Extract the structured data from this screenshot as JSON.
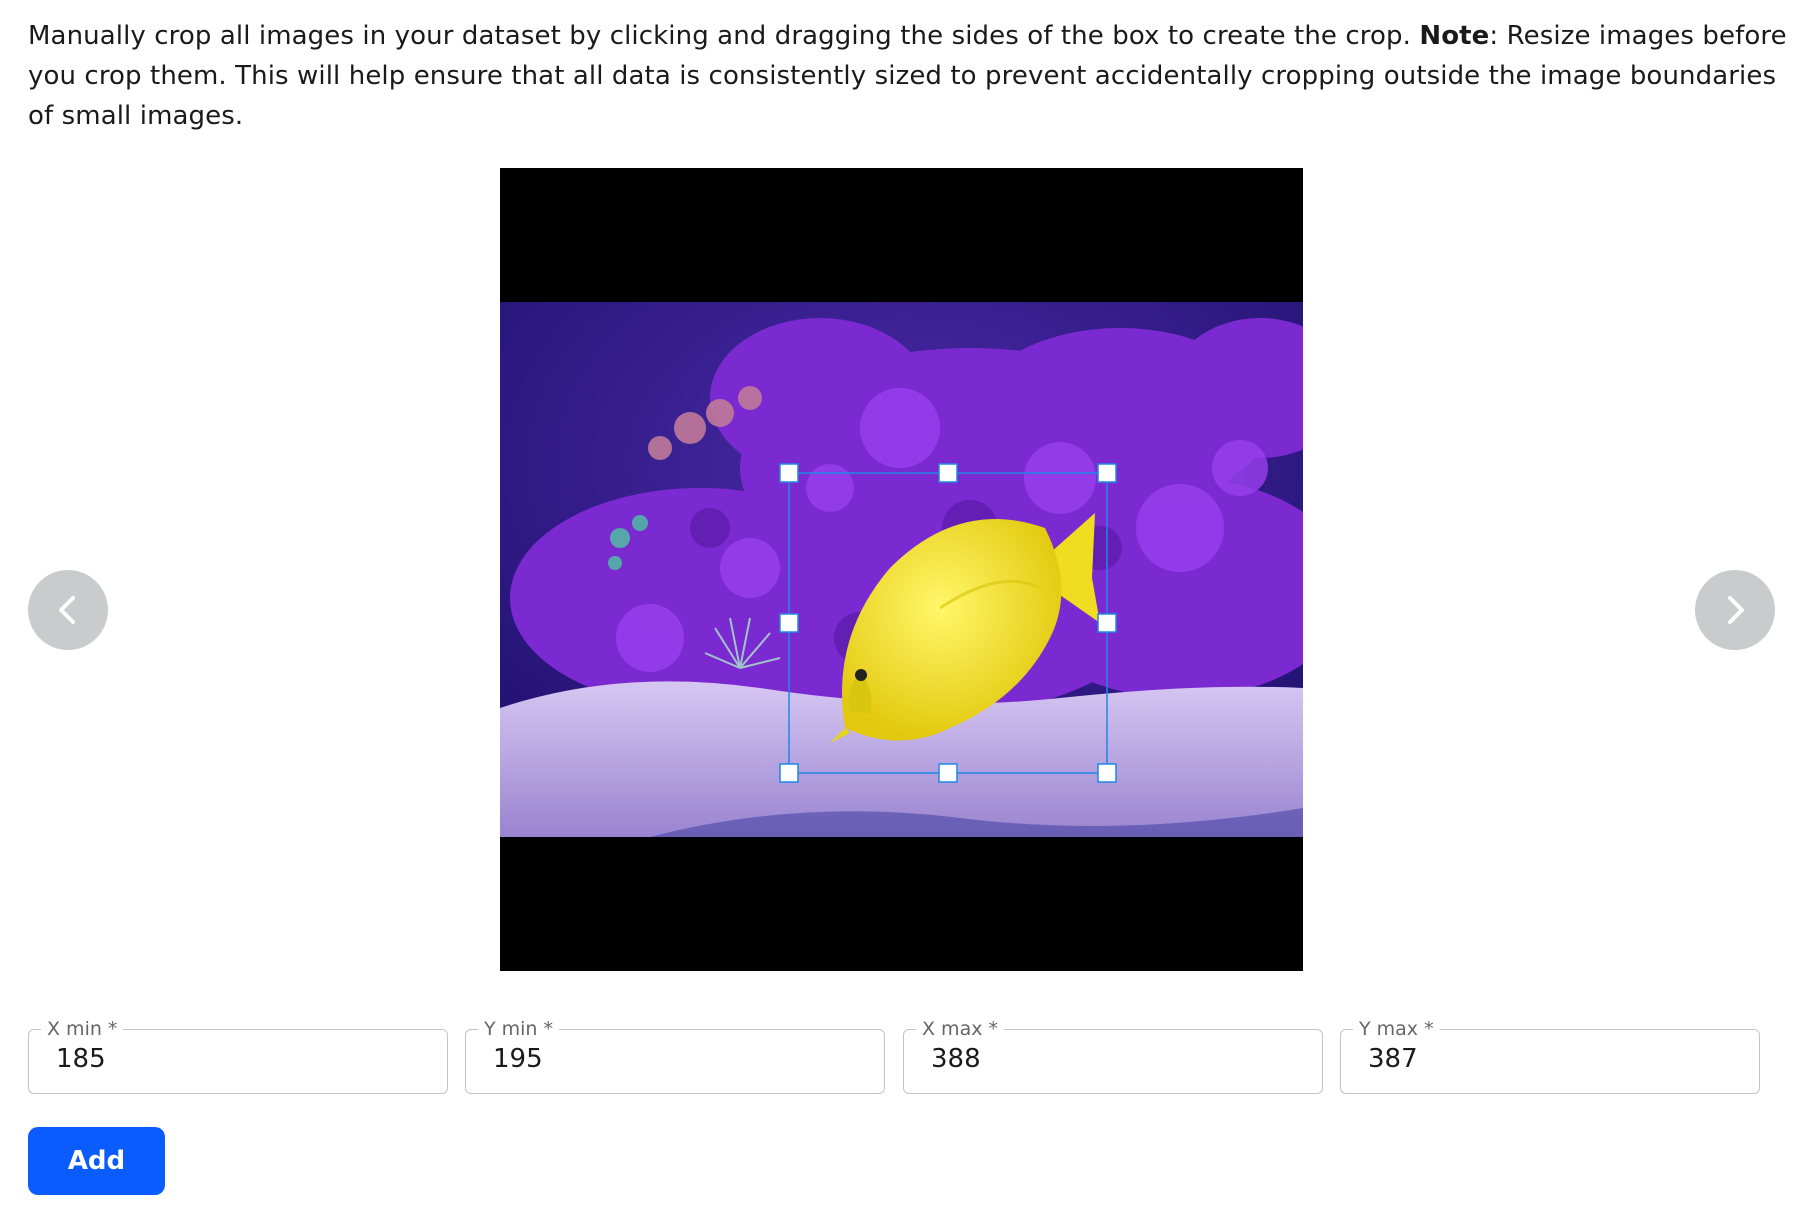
{
  "instructions": {
    "text_before_note": "Manually crop all images in your dataset by clicking and dragging the sides of the box to create the crop. ",
    "note_label": "Note",
    "text_after_note": ": Resize images before you crop them. This will help ensure that all data is consistently sized to prevent accidentally cropping outside the image boundaries of small images."
  },
  "image": {
    "subject": "yellow tang fish in aquarium with purple coral",
    "colors": {
      "letterbox": "#000000",
      "water": "#3a1a8c",
      "coral": "#7a2ad0",
      "sand": "#b9a6e0",
      "fish": "#f3e22a",
      "crop_box": "#1e88e5"
    }
  },
  "navigation": {
    "prev_icon": "chevron-left-icon",
    "next_icon": "chevron-right-icon",
    "button_color": "#c9cbcd"
  },
  "fields": [
    {
      "label": "X min *",
      "value": "185"
    },
    {
      "label": "Y min *",
      "value": "195"
    },
    {
      "label": "X max *",
      "value": "388"
    },
    {
      "label": "Y max *",
      "value": "387"
    }
  ],
  "actions": {
    "add_label": "Add",
    "add_color": "#0a5cff"
  }
}
